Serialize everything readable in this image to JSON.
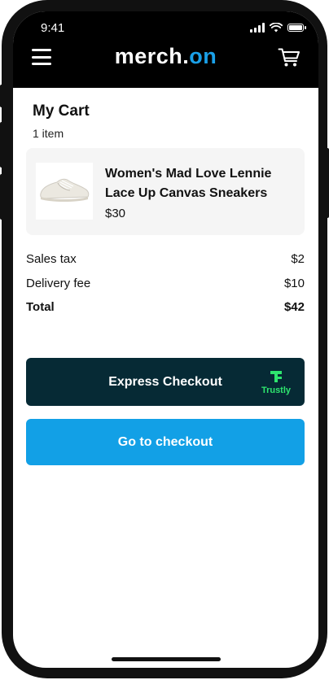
{
  "status_bar": {
    "time": "9:41"
  },
  "header": {
    "logo_part1": "merch.",
    "logo_part2": "on",
    "brand_colors": {
      "logo_primary": "#ffffff",
      "logo_accent": "#1aa0e8",
      "header_bg": "#000000"
    },
    "menu_icon": "hamburger-menu-icon",
    "cart_icon": "shopping-cart-icon"
  },
  "cart": {
    "title": "My Cart",
    "item_count": "1 item",
    "items": [
      {
        "name": "Women's Mad Love Lennie Lace Up Canvas Sneakers",
        "price": "$30",
        "image_icon": "sneaker-image"
      }
    ]
  },
  "summary": {
    "sales_tax_label": "Sales tax",
    "sales_tax_value": "$2",
    "delivery_fee_label": "Delivery fee",
    "delivery_fee_value": "$10",
    "total_label": "Total",
    "total_value": "$42"
  },
  "actions": {
    "express_checkout_label": "Express Checkout",
    "express_checkout_color": "#062a35",
    "trustly_label": "Trustly",
    "trustly_color": "#2ee56e",
    "go_to_checkout_label": "Go to checkout",
    "go_to_checkout_color": "#12a0e6"
  }
}
